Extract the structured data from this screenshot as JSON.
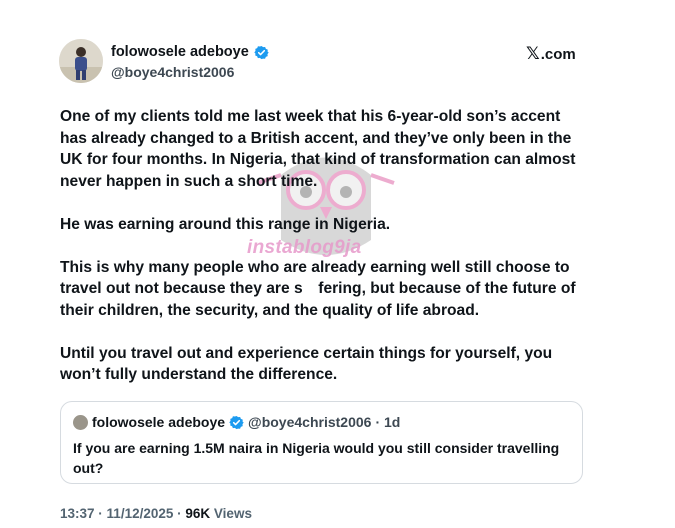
{
  "author": {
    "display_name": "folowosele adeboye",
    "handle": "@boye4christ2006",
    "verified_icon": "verified-badge-icon",
    "avatar": "avatar"
  },
  "brand": {
    "logo_icon": "x-logo-icon",
    "mark": "𝕏",
    "domain": ".com"
  },
  "tweet": {
    "paragraphs": [
      "One of my clients told me last week that his 6-year-old son’s accent\nhas already changed to a British accent, and they’ve only been in the\nUK for four months. In Nigeria, that kind of transformation can almost\nnever happen in such a short time.",
      "He was earning around this range in Nigeria.",
      "This is why many people who are already earning well still choose to\ntravel out not because they are s fering, but because of the future of\ntheir children, the security, and the quality of life abroad.",
      "Until you travel out and experience certain things for yourself, you\nwon’t fully understand the difference."
    ]
  },
  "watermark": {
    "text": "instablog9ja"
  },
  "quoted_tweet": {
    "display_name": "folowosele adeboye",
    "handle": "@boye4christ2006",
    "time": "· 1d",
    "text": "If you are earning 1.5M naira in Nigeria would you still consider travelling\nout?"
  },
  "meta": {
    "time": "13:37",
    "date": "11/12/2025",
    "views_count": "96K",
    "views_label": "Views"
  },
  "colors": {
    "text": "#0f1419",
    "secondary": "#536471",
    "verified": "#1d9bf0",
    "border": "#d6dbe0",
    "watermark_pink": "#e79acb"
  }
}
